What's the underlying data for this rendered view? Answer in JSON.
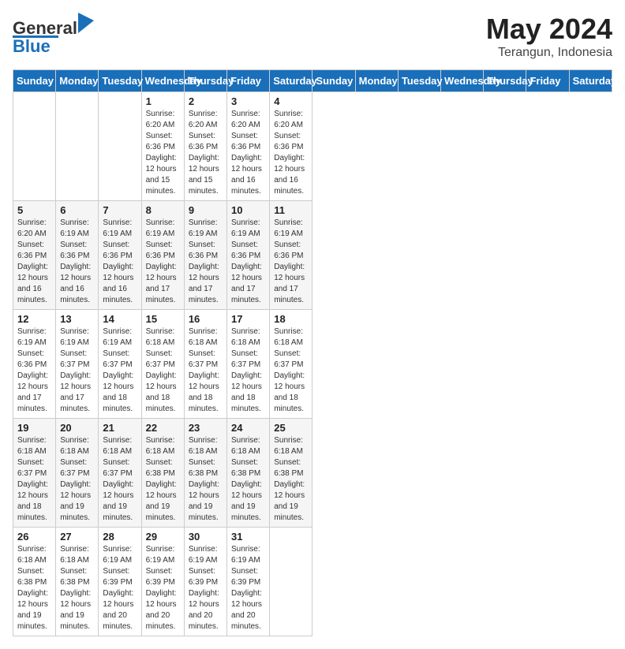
{
  "header": {
    "logo_general": "General",
    "logo_blue": "Blue",
    "month_year": "May 2024",
    "location": "Terangun, Indonesia"
  },
  "days_of_week": [
    "Sunday",
    "Monday",
    "Tuesday",
    "Wednesday",
    "Thursday",
    "Friday",
    "Saturday"
  ],
  "weeks": [
    [
      {
        "day": "",
        "info": ""
      },
      {
        "day": "",
        "info": ""
      },
      {
        "day": "",
        "info": ""
      },
      {
        "day": "1",
        "info": "Sunrise: 6:20 AM\nSunset: 6:36 PM\nDaylight: 12 hours\nand 15 minutes."
      },
      {
        "day": "2",
        "info": "Sunrise: 6:20 AM\nSunset: 6:36 PM\nDaylight: 12 hours\nand 15 minutes."
      },
      {
        "day": "3",
        "info": "Sunrise: 6:20 AM\nSunset: 6:36 PM\nDaylight: 12 hours\nand 16 minutes."
      },
      {
        "day": "4",
        "info": "Sunrise: 6:20 AM\nSunset: 6:36 PM\nDaylight: 12 hours\nand 16 minutes."
      }
    ],
    [
      {
        "day": "5",
        "info": "Sunrise: 6:20 AM\nSunset: 6:36 PM\nDaylight: 12 hours\nand 16 minutes."
      },
      {
        "day": "6",
        "info": "Sunrise: 6:19 AM\nSunset: 6:36 PM\nDaylight: 12 hours\nand 16 minutes."
      },
      {
        "day": "7",
        "info": "Sunrise: 6:19 AM\nSunset: 6:36 PM\nDaylight: 12 hours\nand 16 minutes."
      },
      {
        "day": "8",
        "info": "Sunrise: 6:19 AM\nSunset: 6:36 PM\nDaylight: 12 hours\nand 17 minutes."
      },
      {
        "day": "9",
        "info": "Sunrise: 6:19 AM\nSunset: 6:36 PM\nDaylight: 12 hours\nand 17 minutes."
      },
      {
        "day": "10",
        "info": "Sunrise: 6:19 AM\nSunset: 6:36 PM\nDaylight: 12 hours\nand 17 minutes."
      },
      {
        "day": "11",
        "info": "Sunrise: 6:19 AM\nSunset: 6:36 PM\nDaylight: 12 hours\nand 17 minutes."
      }
    ],
    [
      {
        "day": "12",
        "info": "Sunrise: 6:19 AM\nSunset: 6:36 PM\nDaylight: 12 hours\nand 17 minutes."
      },
      {
        "day": "13",
        "info": "Sunrise: 6:19 AM\nSunset: 6:37 PM\nDaylight: 12 hours\nand 17 minutes."
      },
      {
        "day": "14",
        "info": "Sunrise: 6:19 AM\nSunset: 6:37 PM\nDaylight: 12 hours\nand 18 minutes."
      },
      {
        "day": "15",
        "info": "Sunrise: 6:18 AM\nSunset: 6:37 PM\nDaylight: 12 hours\nand 18 minutes."
      },
      {
        "day": "16",
        "info": "Sunrise: 6:18 AM\nSunset: 6:37 PM\nDaylight: 12 hours\nand 18 minutes."
      },
      {
        "day": "17",
        "info": "Sunrise: 6:18 AM\nSunset: 6:37 PM\nDaylight: 12 hours\nand 18 minutes."
      },
      {
        "day": "18",
        "info": "Sunrise: 6:18 AM\nSunset: 6:37 PM\nDaylight: 12 hours\nand 18 minutes."
      }
    ],
    [
      {
        "day": "19",
        "info": "Sunrise: 6:18 AM\nSunset: 6:37 PM\nDaylight: 12 hours\nand 18 minutes."
      },
      {
        "day": "20",
        "info": "Sunrise: 6:18 AM\nSunset: 6:37 PM\nDaylight: 12 hours\nand 19 minutes."
      },
      {
        "day": "21",
        "info": "Sunrise: 6:18 AM\nSunset: 6:37 PM\nDaylight: 12 hours\nand 19 minutes."
      },
      {
        "day": "22",
        "info": "Sunrise: 6:18 AM\nSunset: 6:38 PM\nDaylight: 12 hours\nand 19 minutes."
      },
      {
        "day": "23",
        "info": "Sunrise: 6:18 AM\nSunset: 6:38 PM\nDaylight: 12 hours\nand 19 minutes."
      },
      {
        "day": "24",
        "info": "Sunrise: 6:18 AM\nSunset: 6:38 PM\nDaylight: 12 hours\nand 19 minutes."
      },
      {
        "day": "25",
        "info": "Sunrise: 6:18 AM\nSunset: 6:38 PM\nDaylight: 12 hours\nand 19 minutes."
      }
    ],
    [
      {
        "day": "26",
        "info": "Sunrise: 6:18 AM\nSunset: 6:38 PM\nDaylight: 12 hours\nand 19 minutes."
      },
      {
        "day": "27",
        "info": "Sunrise: 6:18 AM\nSunset: 6:38 PM\nDaylight: 12 hours\nand 19 minutes."
      },
      {
        "day": "28",
        "info": "Sunrise: 6:19 AM\nSunset: 6:39 PM\nDaylight: 12 hours\nand 20 minutes."
      },
      {
        "day": "29",
        "info": "Sunrise: 6:19 AM\nSunset: 6:39 PM\nDaylight: 12 hours\nand 20 minutes."
      },
      {
        "day": "30",
        "info": "Sunrise: 6:19 AM\nSunset: 6:39 PM\nDaylight: 12 hours\nand 20 minutes."
      },
      {
        "day": "31",
        "info": "Sunrise: 6:19 AM\nSunset: 6:39 PM\nDaylight: 12 hours\nand 20 minutes."
      },
      {
        "day": "",
        "info": ""
      }
    ]
  ]
}
